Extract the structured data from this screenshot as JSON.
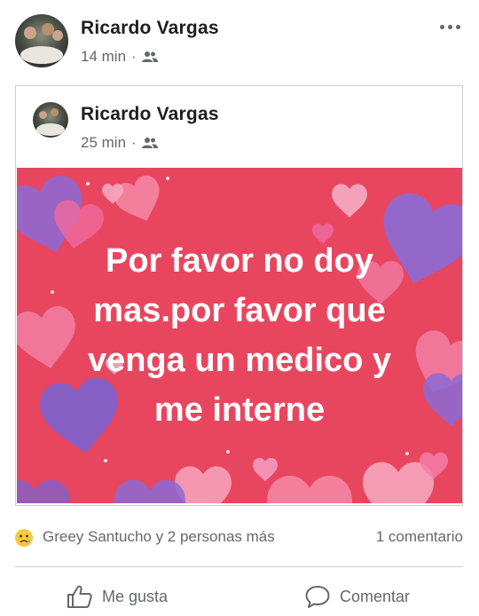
{
  "post": {
    "author": "Ricardo Vargas",
    "time": "14 min",
    "separator": "·",
    "audience_icon": "friends-icon",
    "more_icon": "more-options-icon"
  },
  "shared_post": {
    "author": "Ricardo Vargas",
    "time": "25 min",
    "separator": "·",
    "audience_icon": "friends-icon",
    "card_text": "Por favor no doy mas.por favor que venga un medico y me interne",
    "card_background": "#e8465f"
  },
  "reactions": {
    "icon": "sad-reaction-icon",
    "summary": "Greey Santucho y 2 personas más",
    "comments": "1 comentario"
  },
  "actions": {
    "like_label": "Me gusta",
    "comment_label": "Comentar"
  }
}
